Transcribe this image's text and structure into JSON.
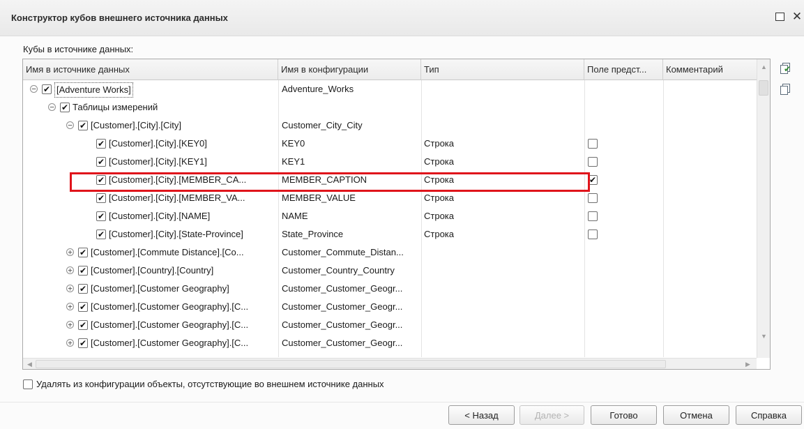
{
  "window": {
    "title": "Конструктор кубов внешнего источника данных",
    "maximize_glyph": "□",
    "close_glyph": "✕"
  },
  "list_label": "Кубы в источнике данных:",
  "columns": {
    "source_name": "Имя в источнике данных",
    "config_name": "Имя в конфигурации",
    "type": "Тип",
    "representation_field": "Поле предст...",
    "comment": "Комментарий"
  },
  "rows": [
    {
      "level": 0,
      "expander": "⊖",
      "checked": true,
      "source": "[Adventure Works]",
      "config": "Adventure_Works",
      "type": "",
      "field": null,
      "selected": true
    },
    {
      "level": 1,
      "expander": "⊖",
      "checked": true,
      "source": "Таблицы измерений",
      "config": "",
      "type": "",
      "field": null
    },
    {
      "level": 2,
      "expander": "⊖",
      "checked": true,
      "source": "[Customer].[City].[City]",
      "config": "Customer_City_City",
      "type": "",
      "field": null
    },
    {
      "level": 3,
      "expander": "",
      "checked": true,
      "source": "[Customer].[City].[KEY0]",
      "config": "KEY0",
      "type": "Строка",
      "field": false
    },
    {
      "level": 3,
      "expander": "",
      "checked": true,
      "source": "[Customer].[City].[KEY1]",
      "config": "KEY1",
      "type": "Строка",
      "field": false
    },
    {
      "level": 3,
      "expander": "",
      "checked": true,
      "source": "[Customer].[City].[MEMBER_CA...",
      "config": "MEMBER_CAPTION",
      "type": "Строка",
      "field": true
    },
    {
      "level": 3,
      "expander": "",
      "checked": true,
      "source": "[Customer].[City].[MEMBER_VA...",
      "config": "MEMBER_VALUE",
      "type": "Строка",
      "field": false
    },
    {
      "level": 3,
      "expander": "",
      "checked": true,
      "source": "[Customer].[City].[NAME]",
      "config": "NAME",
      "type": "Строка",
      "field": false
    },
    {
      "level": 3,
      "expander": "",
      "checked": true,
      "source": "[Customer].[City].[State-Province]",
      "config": "State_Province",
      "type": "Строка",
      "field": false
    },
    {
      "level": 2,
      "expander": "⊕",
      "checked": true,
      "source": "[Customer].[Commute Distance].[Co...",
      "config": "Customer_Commute_Distan...",
      "type": "",
      "field": null
    },
    {
      "level": 2,
      "expander": "⊕",
      "checked": true,
      "source": "[Customer].[Country].[Country]",
      "config": "Customer_Country_Country",
      "type": "",
      "field": null
    },
    {
      "level": 2,
      "expander": "⊕",
      "checked": true,
      "source": "[Customer].[Customer Geography]",
      "config": "Customer_Customer_Geogr...",
      "type": "",
      "field": null
    },
    {
      "level": 2,
      "expander": "⊕",
      "checked": true,
      "source": "[Customer].[Customer Geography].[C...",
      "config": "Customer_Customer_Geogr...",
      "type": "",
      "field": null
    },
    {
      "level": 2,
      "expander": "⊕",
      "checked": true,
      "source": "[Customer].[Customer Geography].[C...",
      "config": "Customer_Customer_Geogr...",
      "type": "",
      "field": null
    },
    {
      "level": 2,
      "expander": "⊕",
      "checked": true,
      "source": "[Customer].[Customer Geography].[C...",
      "config": "Customer_Customer_Geogr...",
      "type": "",
      "field": null
    }
  ],
  "check_glyph": "✔",
  "side_buttons": [
    "check-all-icon",
    "uncheck-all-icon"
  ],
  "remove_missing": {
    "checked": false,
    "label": "Удалять из конфигурации объекты, отсутствующие во внешнем источнике данных"
  },
  "buttons": {
    "back": "< Назад",
    "next": "Далее >",
    "done": "Готово",
    "cancel": "Отмена",
    "help": "Справка"
  },
  "colors": {
    "highlight": "#e0141b"
  }
}
